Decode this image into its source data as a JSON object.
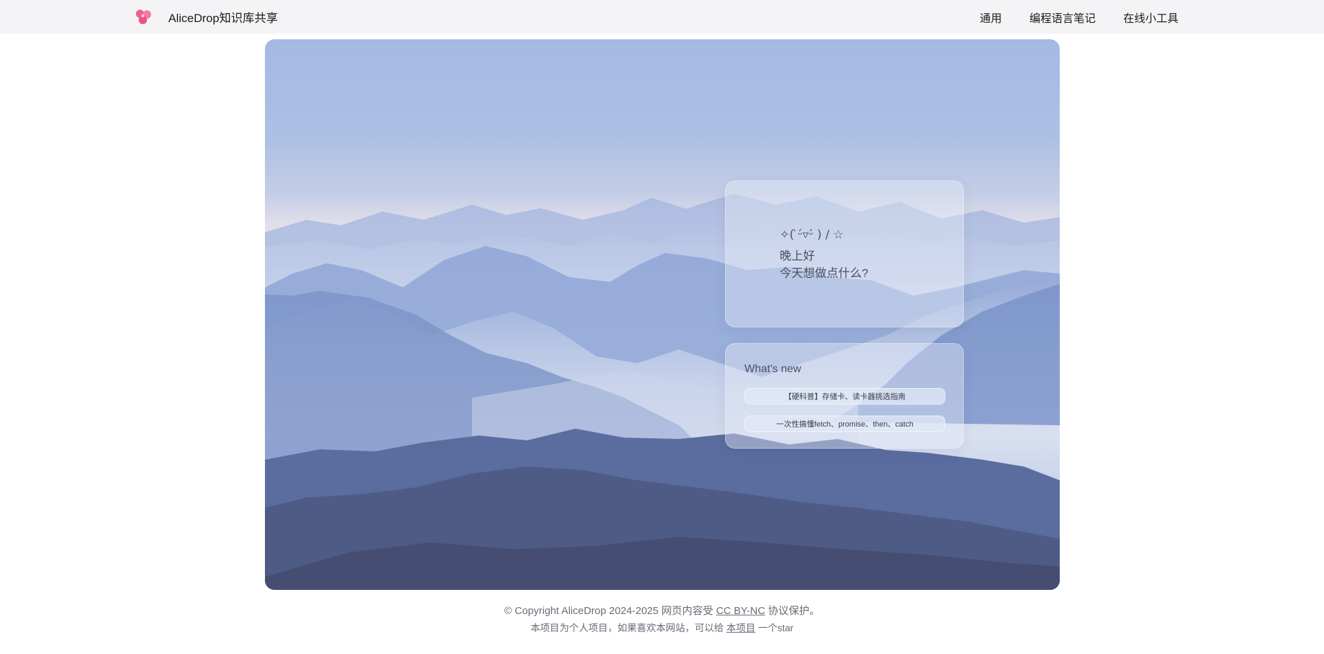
{
  "header": {
    "logo_icon": "petals-logo-icon",
    "brand_color": "#f06289",
    "title": "AliceDrop知识库共享",
    "nav": [
      {
        "label": "通用"
      },
      {
        "label": "编程语言笔记"
      },
      {
        "label": "在线小工具"
      }
    ]
  },
  "hero": {
    "background": "misty-blue-mountains",
    "greeting": {
      "kaomoji": "✧( ̀ᵕ́▿ᵕ́ ) / ☆",
      "line1": "晚上好",
      "line2": "今天想做点什么?"
    },
    "whats_new": {
      "title": "What's new",
      "items": [
        {
          "label": "【硬科普】存储卡、读卡器挑选指南"
        },
        {
          "label": "一次性搞懂fetch、promise、then、catch"
        }
      ]
    }
  },
  "footer": {
    "copyright_prefix": "© Copyright AliceDrop 2024-2025 网页内容受",
    "license_link": "CC BY-NC",
    "copyright_suffix": "协议保护。",
    "star_prefix": "本项目为个人项目，如果喜欢本网站，可以给",
    "project_link": "本项目",
    "star_suffix": "一个star"
  }
}
